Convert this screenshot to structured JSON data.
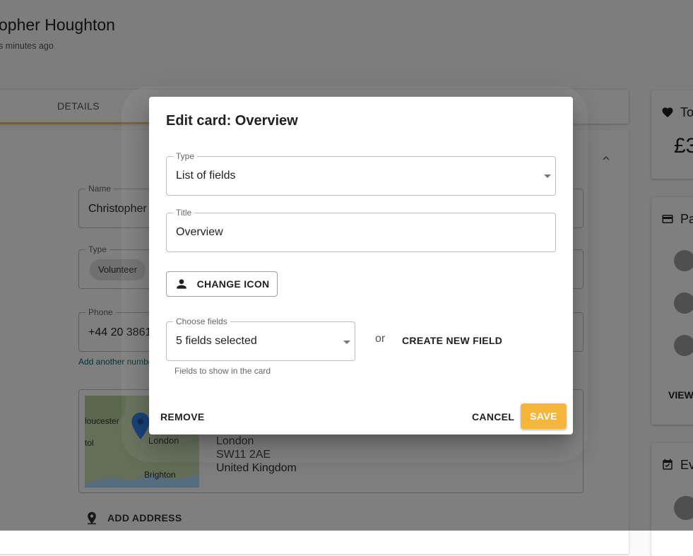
{
  "background": {
    "person_name": "opher Houghton",
    "updated": "s minutes ago",
    "tabs": {
      "details": "DETAILS"
    },
    "name_field": {
      "label": "Name",
      "value": "Christopher"
    },
    "type_field": {
      "label": "Type",
      "chip": "Volunteer"
    },
    "phone_field": {
      "label": "Phone",
      "value": "+44 20 3861"
    },
    "add_phone_link": "Add another numbe",
    "map_labels": {
      "gloucester": "loucester",
      "oxford": "tol",
      "london": "London",
      "brighton": "Brighton"
    },
    "address_lines": [
      "London",
      "SW11 2AE",
      "United Kingdom"
    ],
    "add_address": "ADD ADDRESS",
    "right_cards": {
      "total_title": "To",
      "total_value": "£3",
      "payments_title": "Pa",
      "view_label": "VIEW",
      "events_title": "Ev"
    }
  },
  "dialog": {
    "title": "Edit card: Overview",
    "type_field": {
      "label": "Type",
      "value": "List of fields"
    },
    "title_field": {
      "label": "Title",
      "value": "Overview"
    },
    "change_icon": "CHANGE ICON",
    "fields_select": {
      "label": "Choose fields",
      "value": "5 fields selected",
      "helper": "Fields to show in the card"
    },
    "or_text": "or",
    "create_field": "CREATE NEW FIELD",
    "remove": "REMOVE",
    "cancel": "CANCEL",
    "save": "SAVE"
  },
  "colors": {
    "accent": "#f5b63a",
    "link": "#0b6e61",
    "scrim": "rgba(0,0,0,0.5)"
  }
}
